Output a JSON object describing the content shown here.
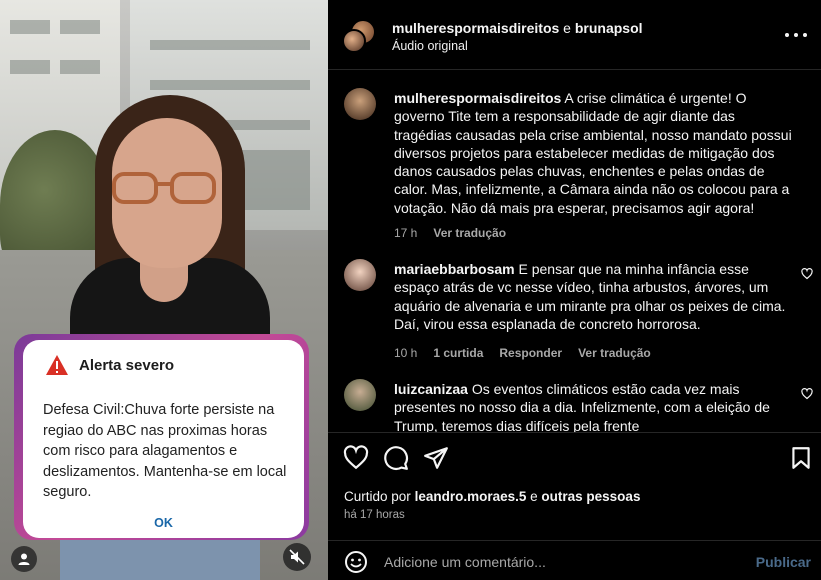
{
  "video": {
    "alert": {
      "title": "Alerta severo",
      "body": "Defesa Civil:Chuva forte persiste na regiao do ABC nas proximas horas com risco para alagamentos e deslizamentos. Mantenha-se em local seguro.",
      "ok_label": "OK",
      "icon": "warning-triangle-icon"
    },
    "user_icon": "user-icon",
    "mute_icon": "speaker-muted-icon"
  },
  "header": {
    "user1": "mulherespormaisdireitos",
    "separator": "e",
    "user2": "brunapsol",
    "audio": "Áudio original"
  },
  "caption": {
    "user": "mulherespormaisdireitos",
    "text": "A crise climática é urgente! O governo Tite tem a responsabilidade de agir diante das tragédias causadas pela crise ambiental, nosso mandato possui diversos projetos para estabelecer medidas de mitigação dos danos causados pelas chuvas, enchentes e pelas ondas de calor. Mas, infelizmente, a Câmara ainda não os colocou para a votação. Não dá mais pra esperar, precisamos agir agora!",
    "time": "17 h",
    "translate": "Ver tradução"
  },
  "comments": [
    {
      "user": "mariaebbarbosam",
      "text": "E pensar que na minha infância esse espaço atrás de vc nesse vídeo, tinha arbustos, árvores, um aquário de alvenaria e um mirante pra olhar os peixes de cima. Daí, virou essa esplanada de concreto horrorosa.",
      "time": "10 h",
      "likes": "1 curtida",
      "reply": "Responder",
      "translate": "Ver tradução"
    },
    {
      "user": "luizcanizaa",
      "text": "Os eventos climáticos estão cada vez mais presentes no nosso dia a dia. Infelizmente, com a eleição de Trump, teremos dias difíceis pela frente"
    }
  ],
  "actions": {
    "liked_by_prefix": "Curtido por",
    "liked_by_user": "leandro.moraes.5",
    "liked_by_and": "e",
    "liked_by_others": "outras pessoas",
    "time_ago": "há 17 horas"
  },
  "compose": {
    "placeholder": "Adicione um comentário...",
    "publish": "Publicar"
  },
  "colors": {
    "background": "#000000",
    "text": "#f5f5f5",
    "muted": "#a8a8a8",
    "alert_frame": "#c34a96",
    "alert_ok": "#1a67a8",
    "warning_red": "#d93025"
  }
}
